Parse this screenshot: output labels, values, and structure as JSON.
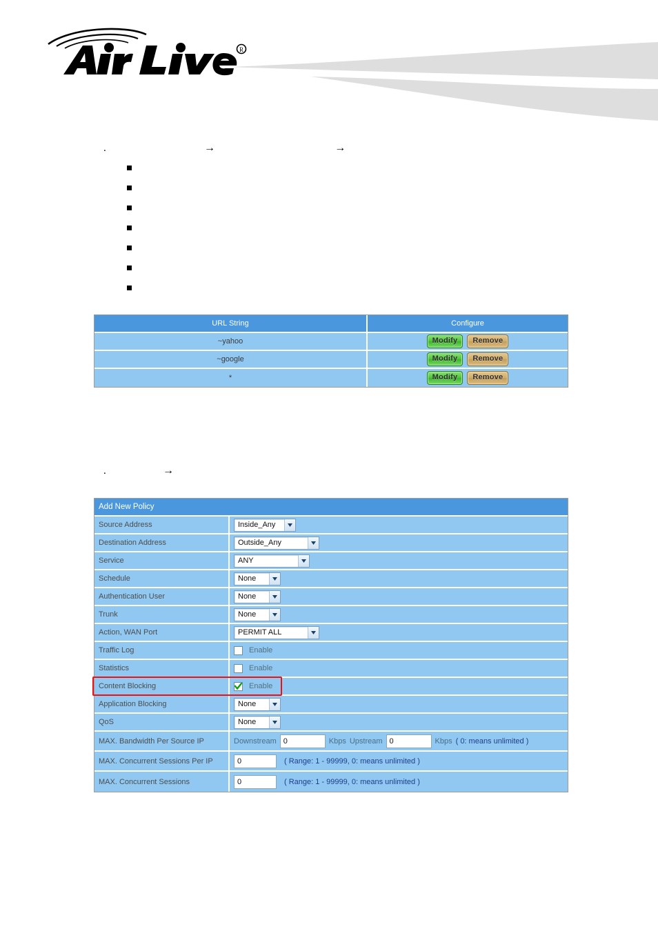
{
  "header": {
    "brand_name": "Air Live",
    "brand_trademark": "®",
    "logo_icon": "airlive-wifi-wave-logo",
    "swoosh_icon": "header-swoosh-graphic",
    "swoosh_color": "#dedede"
  },
  "doc": {
    "section_1": {
      "number": ".",
      "arrow": "→",
      "part_1": "",
      "part_2": "",
      "part_3": ""
    },
    "section_2": {
      "number": ".",
      "arrow": "→",
      "part_1": "",
      "part_2": ""
    },
    "bullets": [
      {
        "text": ""
      },
      {
        "text": ""
      },
      {
        "text": ""
      },
      {
        "text": ""
      },
      {
        "text": ""
      },
      {
        "text": ""
      },
      {
        "text": ""
      }
    ]
  },
  "url_table": {
    "headers": {
      "url": "URL String",
      "configure": "Configure"
    },
    "rows": [
      {
        "url": "~yahoo",
        "modify": "Modify",
        "remove": "Remove"
      },
      {
        "url": "~google",
        "modify": "Modify",
        "remove": "Remove"
      },
      {
        "url": "*",
        "modify": "Modify",
        "remove": "Remove"
      }
    ]
  },
  "policy": {
    "title": "Add New Policy",
    "rows": {
      "source_address": {
        "label": "Source Address",
        "value": "Inside_Any"
      },
      "destination_address": {
        "label": "Destination Address",
        "value": "Outside_Any"
      },
      "service": {
        "label": "Service",
        "value": "ANY"
      },
      "schedule": {
        "label": "Schedule",
        "value": "None"
      },
      "authentication_user": {
        "label": "Authentication User",
        "value": "None"
      },
      "trunk": {
        "label": "Trunk",
        "value": "None"
      },
      "action_wan_port": {
        "label": "Action, WAN Port",
        "value": "PERMIT ALL"
      },
      "traffic_log": {
        "label": "Traffic Log",
        "enable_label": "Enable",
        "checked": false
      },
      "statistics": {
        "label": "Statistics",
        "enable_label": "Enable",
        "checked": false
      },
      "content_blocking": {
        "label": "Content Blocking",
        "enable_label": "Enable",
        "checked": true
      },
      "application_blocking": {
        "label": "Application Blocking",
        "value": "None"
      },
      "qos": {
        "label": "QoS",
        "value": "None"
      },
      "max_bandwidth": {
        "label": "MAX. Bandwidth Per Source IP",
        "downstream_caption": "Downstream",
        "downstream_value": "0",
        "downstream_unit": "Kbps",
        "upstream_caption": "Upstream",
        "upstream_value": "0",
        "upstream_unit": "Kbps",
        "hint": "( 0: means unlimited )"
      },
      "max_sessions_per_ip": {
        "label": "MAX. Concurrent Sessions Per IP",
        "value": "0",
        "hint": "( Range: 1 - 99999, 0: means unlimited )"
      },
      "max_sessions": {
        "label": "MAX. Concurrent Sessions",
        "value": "0",
        "hint": "( Range: 1 - 99999, 0: means unlimited )"
      }
    },
    "highlight_color": "#ee1111",
    "highlight_target": "content_blocking"
  },
  "theme": {
    "table_header_blue": "#4a97de",
    "table_row_blue": "#90c8f2",
    "modify_button_green": "#4ec53a",
    "remove_button_tan": "#d3ad6a",
    "hint_blue": "#1f3d8a"
  }
}
